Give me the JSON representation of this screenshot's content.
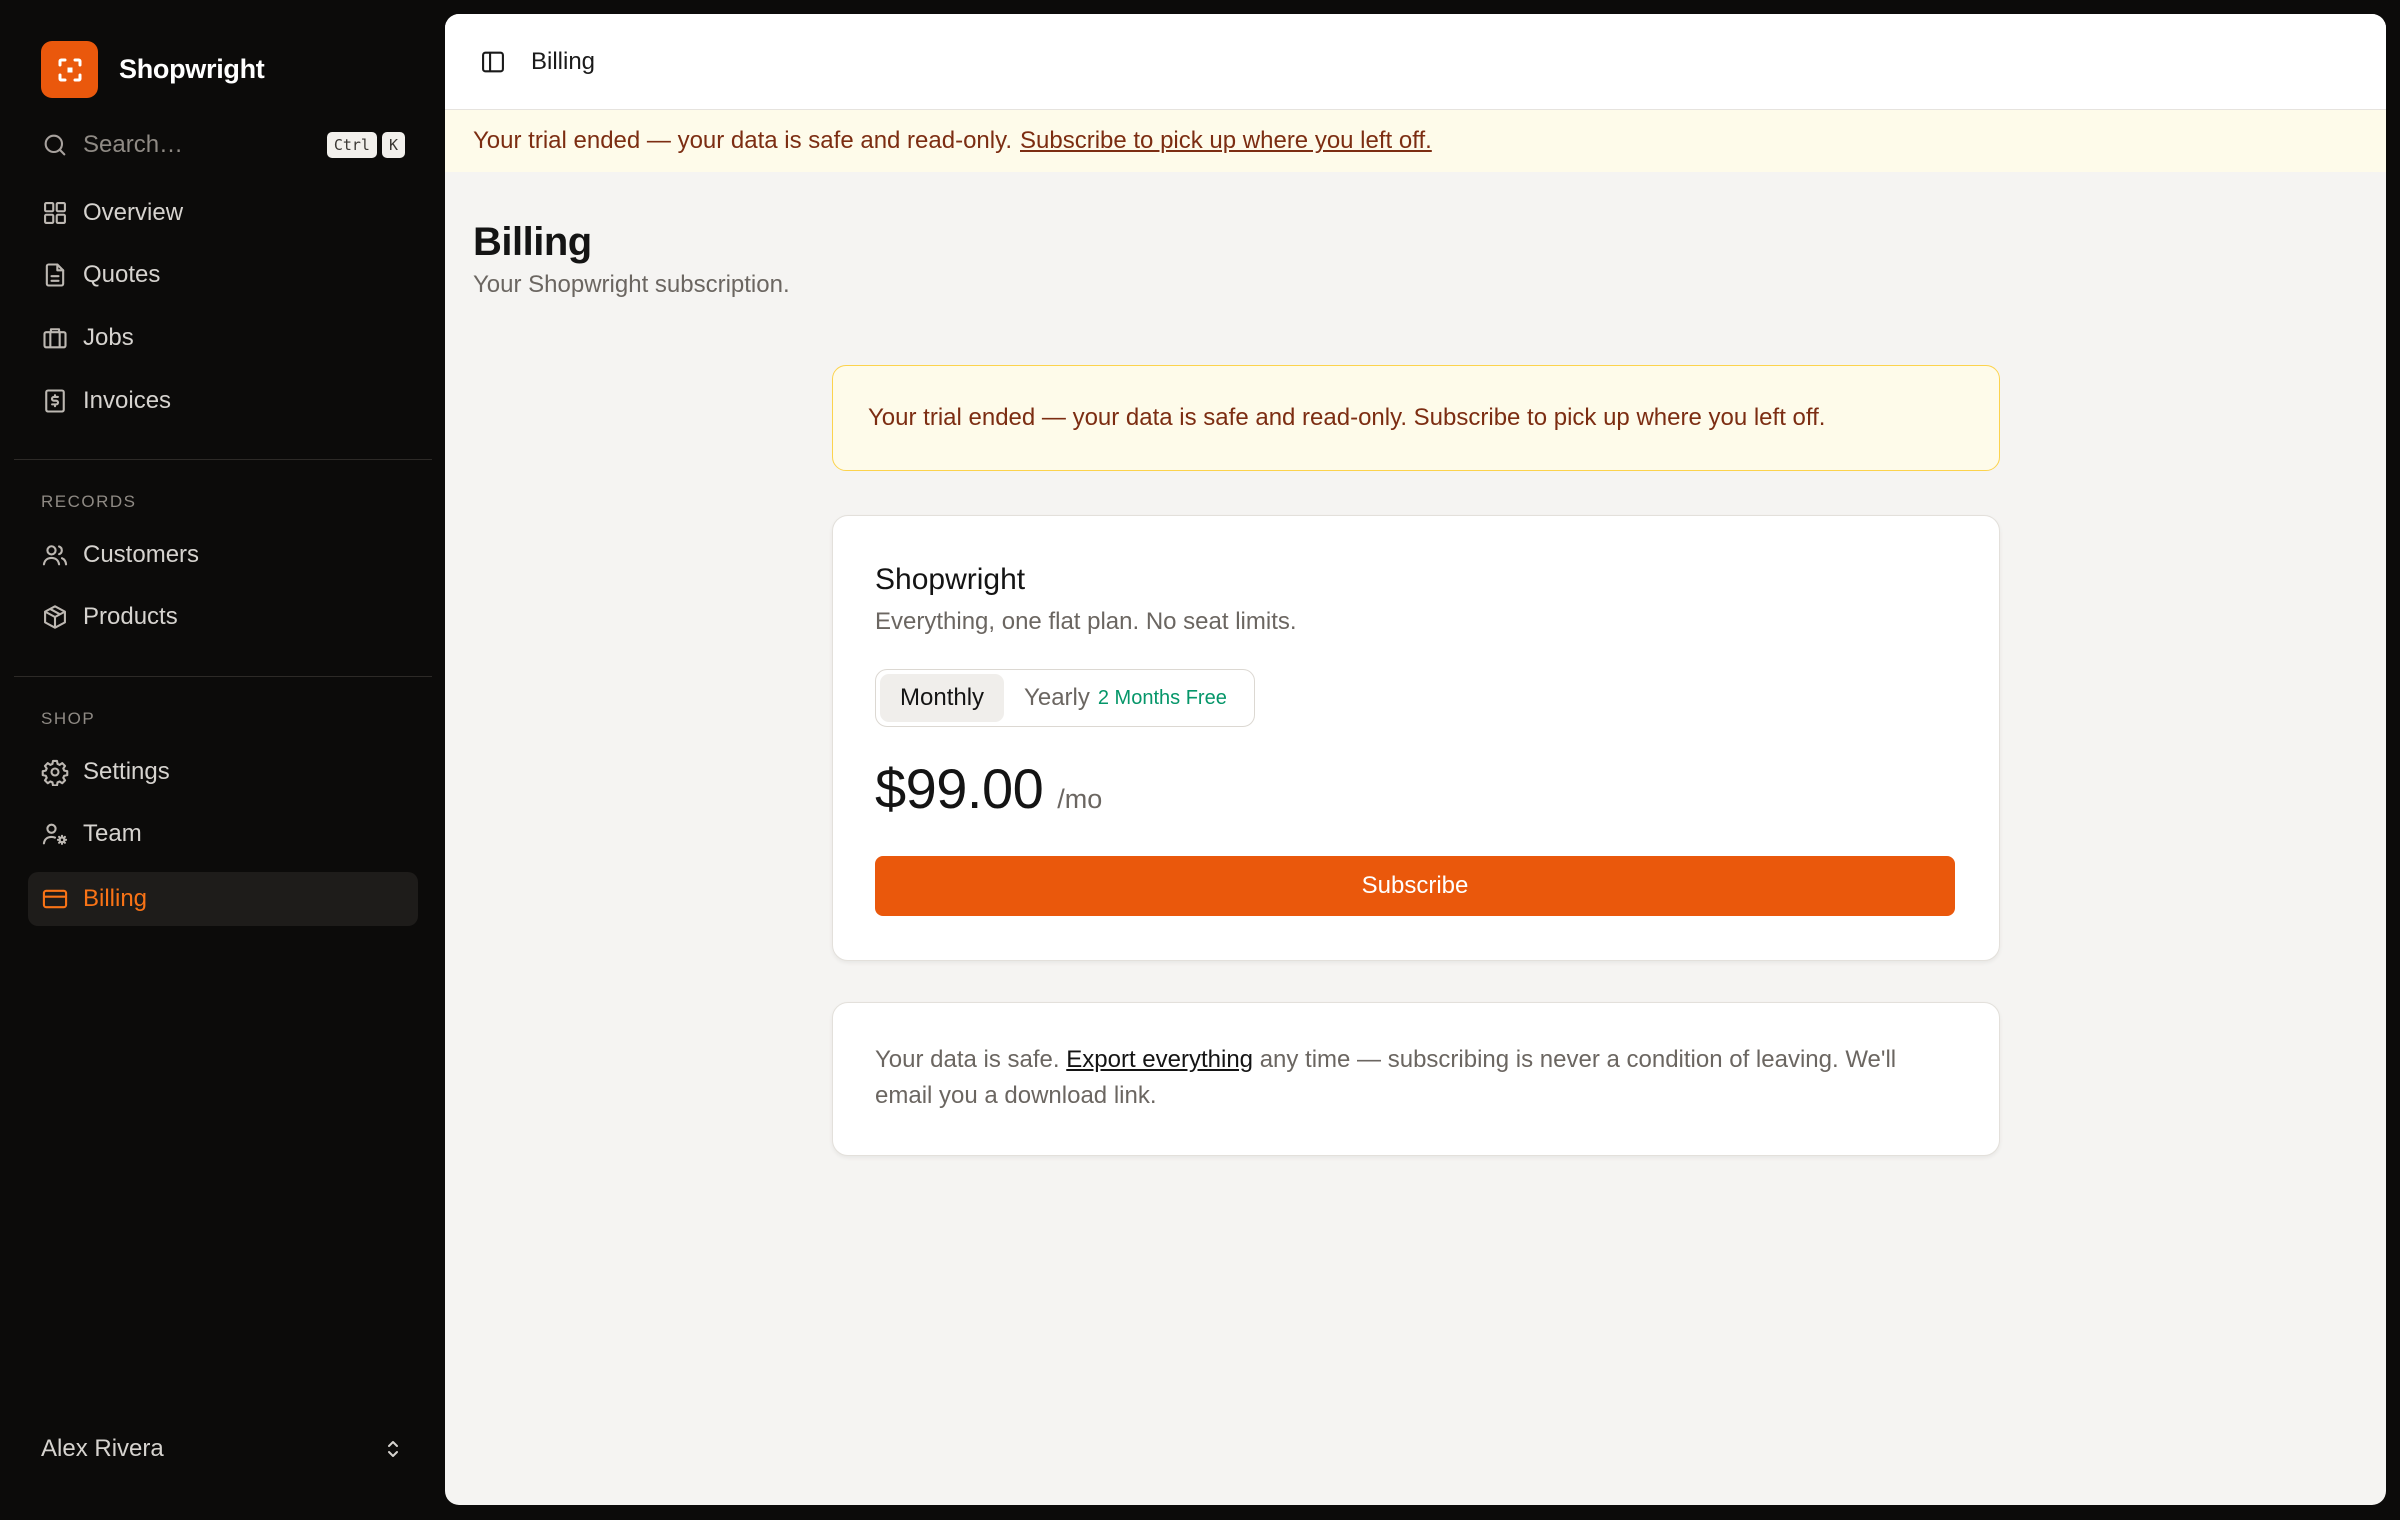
{
  "brand": {
    "name": "Shopwright",
    "logo_icon": "scan-icon",
    "accent": "#ea580c"
  },
  "search": {
    "placeholder": "Search…",
    "shortcut_keys": [
      "Ctrl",
      "K"
    ]
  },
  "sidebar": {
    "main_items": [
      {
        "label": "Overview",
        "icon": "grid-icon"
      },
      {
        "label": "Quotes",
        "icon": "file-text-icon"
      },
      {
        "label": "Jobs",
        "icon": "briefcase-icon"
      },
      {
        "label": "Invoices",
        "icon": "receipt-icon"
      }
    ],
    "records_label": "RECORDS",
    "records_items": [
      {
        "label": "Customers",
        "icon": "users-icon"
      },
      {
        "label": "Products",
        "icon": "package-icon"
      }
    ],
    "shop_label": "SHOP",
    "shop_items": [
      {
        "label": "Settings",
        "icon": "gear-icon"
      },
      {
        "label": "Team",
        "icon": "user-cog-icon"
      },
      {
        "label": "Billing",
        "icon": "credit-card-icon",
        "active": true
      }
    ],
    "user": {
      "name": "Alex Rivera"
    }
  },
  "topbar": {
    "breadcrumb": "Billing"
  },
  "trial_banner": {
    "text": "Your trial ended — your data is safe and read-only.",
    "link": "Subscribe to pick up where you left off."
  },
  "page": {
    "title": "Billing",
    "subtitle": "Your Shopwright subscription."
  },
  "notice": {
    "text": "Your trial ended — your data is safe and read-only. Subscribe to pick up where you left off."
  },
  "plan": {
    "name": "Shopwright",
    "description": "Everything, one flat plan. No seat limits.",
    "billing_options": [
      {
        "label": "Monthly",
        "selected": true
      },
      {
        "label": "Yearly",
        "badge": "2 Months Free",
        "selected": false
      }
    ],
    "price": "$99.00",
    "period": "/mo",
    "subscribe_label": "Subscribe"
  },
  "data_safe": {
    "prefix": "Your data is safe.",
    "link": "Export everything",
    "suffix": "any time — subscribing is never a condition of leaving. We'll email you a download link."
  }
}
